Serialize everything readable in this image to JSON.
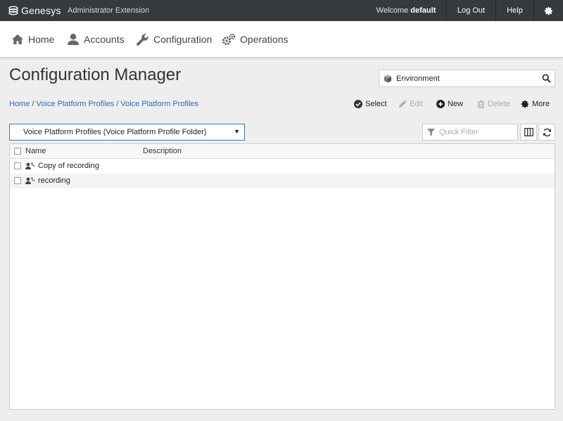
{
  "topbar": {
    "brand": "Genesys",
    "app_name": "Administrator Extension",
    "welcome_prefix": "Welcome",
    "welcome_user": "default",
    "logout_label": "Log Out",
    "help_label": "Help"
  },
  "nav": {
    "home": "Home",
    "accounts": "Accounts",
    "configuration": "Configuration",
    "operations": "Operations"
  },
  "page": {
    "title": "Configuration Manager",
    "environment": "Environment"
  },
  "breadcrumb": {
    "home": "Home",
    "level1": "Voice Platform Profiles",
    "level2": "Voice Platform Profiles"
  },
  "actions": {
    "select": "Select",
    "edit": "Edit",
    "new": "New",
    "delete": "Delete",
    "more": "More"
  },
  "folder": {
    "selected": "Voice Platform Profiles (Voice Platform Profile Folder)"
  },
  "filter": {
    "placeholder": "Quick Filter"
  },
  "table": {
    "columns": {
      "name": "Name",
      "description": "Description"
    },
    "rows": [
      {
        "name": "Copy of recording"
      },
      {
        "name": "recording"
      }
    ]
  },
  "colors": {
    "topbar": "#36393d",
    "link": "#2a6ebb",
    "accent_border": "#3b78c7",
    "background": "#eeeeee"
  }
}
